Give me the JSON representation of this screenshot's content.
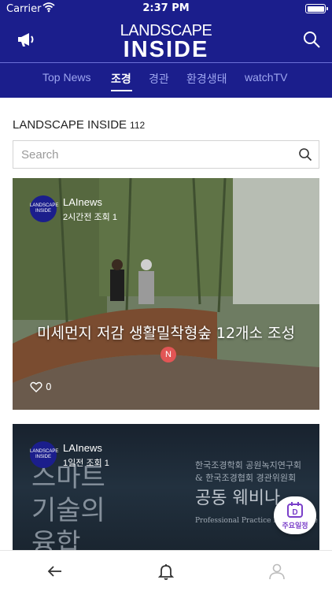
{
  "status_bar": {
    "carrier": "Carrier",
    "time": "2:37 PM"
  },
  "header": {
    "logo_line1": "LANDSCAPE",
    "logo_line2": "INSIDE"
  },
  "tabs": [
    {
      "label": "Top News",
      "active": false
    },
    {
      "label": "조경",
      "active": true
    },
    {
      "label": "경관",
      "active": false
    },
    {
      "label": "환경생태",
      "active": false
    },
    {
      "label": "watchTV",
      "active": false
    }
  ],
  "section": {
    "title": "LANDSCAPE INSIDE",
    "count": "112"
  },
  "search": {
    "placeholder": "Search"
  },
  "posts": [
    {
      "avatar_text": "LANDSCAPE INSIDE",
      "author": "LAInews",
      "meta": "2시간전  조회 1",
      "headline": "미세먼지 저감 생활밀착형숲 12개소 조성",
      "badge": "N",
      "likes": "0"
    },
    {
      "avatar_text": "LANDSCAPE INSIDE",
      "author": "LAInews",
      "meta": "1일전  조회 1",
      "image_text": {
        "big_lines": [
          "스마트",
          "기술의",
          "융합"
        ],
        "right_lines": [
          "한국조경학회 공원녹지연구회",
          "& 한국조경협회 경관위원회"
        ],
        "right_title": "공동 웨비나",
        "right_subtitle": "Professional Practice Network We"
      }
    }
  ],
  "fab": {
    "label": "주요일정",
    "icon_letter": "D"
  },
  "icons": {
    "header_left": "megaphone-icon",
    "header_right": "search-icon",
    "nav": [
      "back-arrow-icon",
      "bell-icon",
      "user-icon"
    ]
  },
  "colors": {
    "brand": "#1b1e8c",
    "tab_inactive": "#9ea6f0",
    "badge": "#e25555",
    "fab_accent": "#7a3fc9"
  }
}
